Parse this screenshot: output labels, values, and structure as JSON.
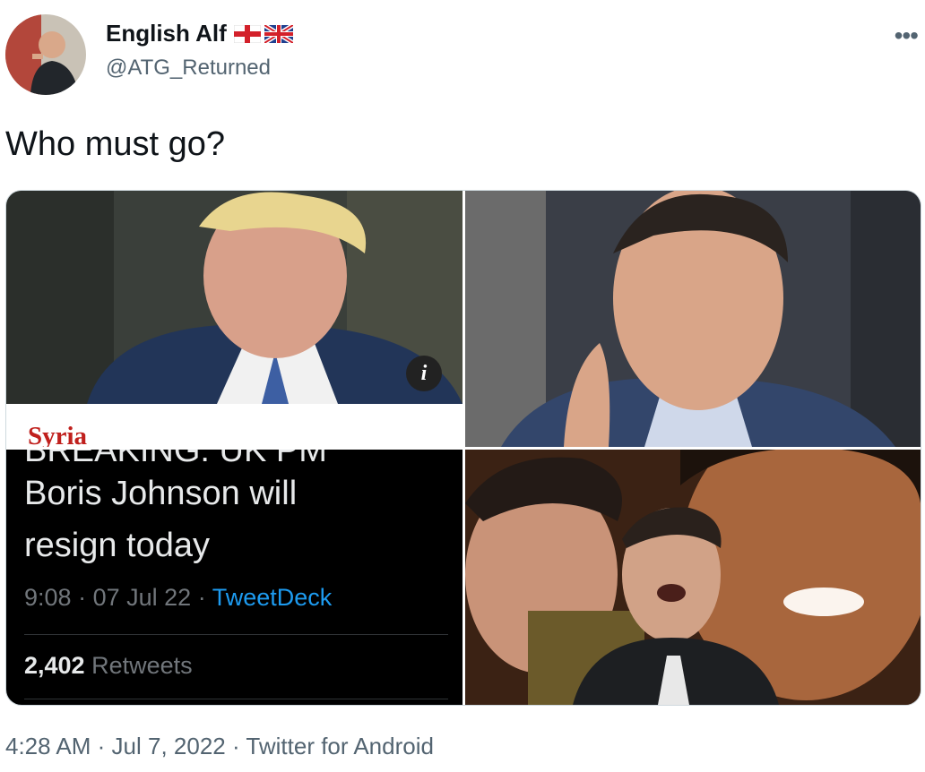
{
  "author": {
    "display_name": "English Alf",
    "flags": [
      "england-flag-icon",
      "uk-flag-icon"
    ],
    "handle": "@ATG_Returned"
  },
  "tweet": {
    "text": "Who must go?"
  },
  "media": {
    "cell1": {
      "caption_tag": "Syria",
      "info_badge": "i"
    },
    "cell3": {
      "clipped_line": "BREAKING: UK PM",
      "line1": "Boris Johnson will",
      "line2": "resign today",
      "time": "9:08",
      "date": "07 Jul 22",
      "source": "TweetDeck",
      "retweets_count": "2,402",
      "retweets_label": "Retweets"
    }
  },
  "footer": {
    "time": "4:28 AM",
    "date": "Jul 7, 2022",
    "source": "Twitter for Android"
  },
  "menu": {
    "more_glyph": "•••"
  }
}
